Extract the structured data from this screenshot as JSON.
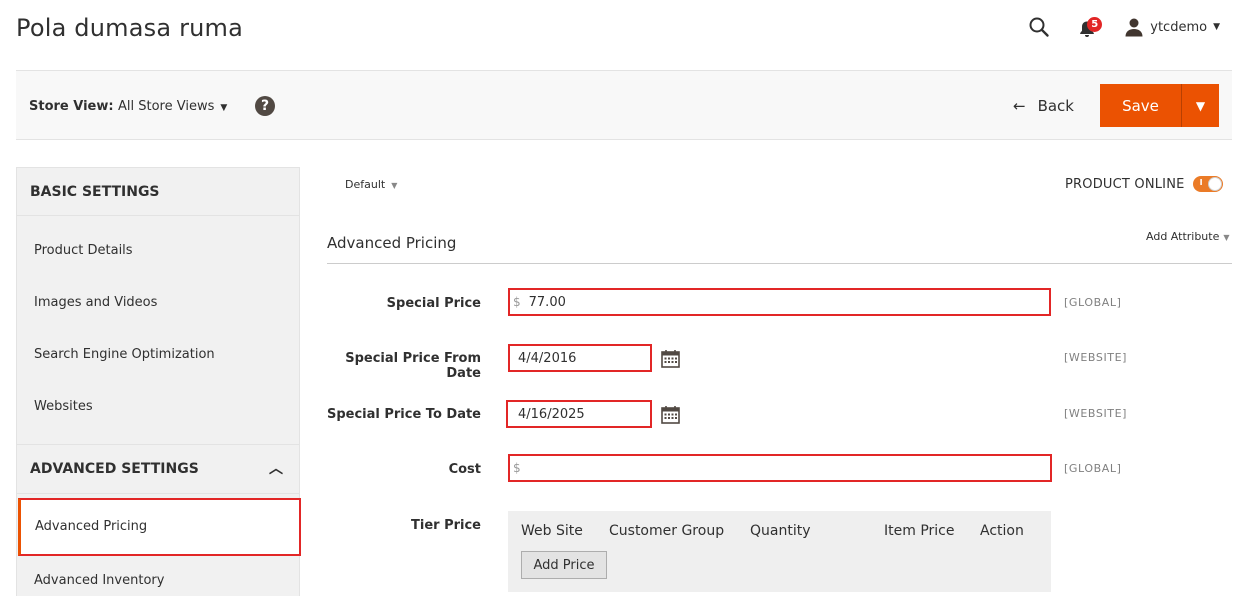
{
  "header": {
    "title": "Pola dumasa ruma",
    "notifications_count": "5",
    "username": "ytcdemo",
    "icons": {
      "search": "search-icon",
      "notifications": "bell-icon",
      "user": "user-icon"
    }
  },
  "store_bar": {
    "label": "Store View:",
    "store_view": "All Store Views",
    "help_glyph": "?",
    "back_label": "Back",
    "save_label": "Save"
  },
  "sidebar": {
    "basic_heading": "BASIC SETTINGS",
    "basic_items": [
      "Product Details",
      "Images and Videos",
      "Search Engine Optimization",
      "Websites"
    ],
    "advanced_heading": "ADVANCED SETTINGS",
    "advanced_items": [
      "Advanced Pricing",
      "Advanced Inventory"
    ],
    "active_item": "Advanced Pricing"
  },
  "main": {
    "scope": "Default",
    "product_online_label": "PRODUCT ONLINE",
    "product_online": true,
    "toggle_mark": "I",
    "section_title": "Advanced Pricing",
    "add_attribute": "Add Attribute",
    "currency_symbol": "$",
    "fields": {
      "special_price": {
        "label": "Special Price",
        "value": "77.00",
        "scope": "[GLOBAL]"
      },
      "special_from": {
        "label": "Special Price From Date",
        "value": "4/4/2016",
        "scope": "[WEBSITE]"
      },
      "special_to": {
        "label": "Special Price To Date",
        "value": "4/16/2025",
        "scope": "[WEBSITE]"
      },
      "cost": {
        "label": "Cost",
        "value": "",
        "scope": "[GLOBAL]"
      }
    },
    "tier_price": {
      "label": "Tier Price",
      "columns": [
        "Web Site",
        "Customer Group",
        "Quantity",
        "Item Price",
        "Action"
      ],
      "add_button": "Add Price"
    }
  },
  "colors": {
    "accent": "#eb5202",
    "highlight": "#e22626",
    "badge": "#e22626"
  }
}
